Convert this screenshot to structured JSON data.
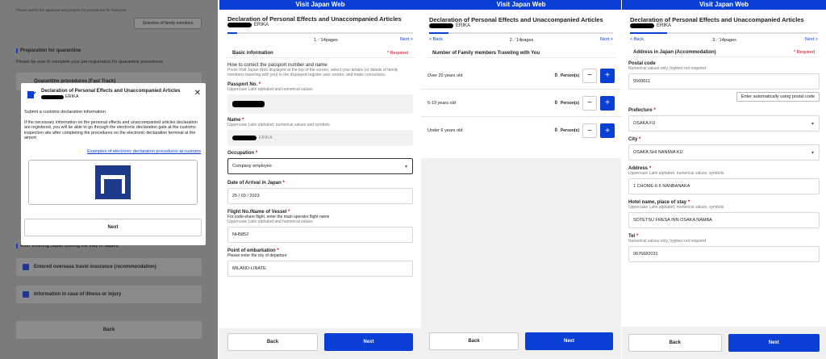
{
  "app_title": "Visit Japan Web",
  "doc_title": "Declaration of Personal Effects and Unaccompanied Articles",
  "name_suffix": "ERIKA",
  "nav": {
    "back": "< Back",
    "next": "Next >"
  },
  "panel1": {
    "top_note": "Please switch the applicant and prepare for procedures for everyone",
    "family_button": "Selection of family members",
    "quarantine_heading": "Preparation for quarantine",
    "quarantine_desc": "Please be sure to complete your pre-registration for quarantine procedures",
    "fast_track": "Quarantine procedures (Fast Track)",
    "after_heading": "After entering Japan (during the stay in Japan)",
    "insurance": "Entered overseas travel insurance (recommendation)",
    "illness": "Information in case of illness or injury",
    "back": "Back",
    "modal": {
      "title": "Declaration of Personal Effects and Unaccompanied Articles",
      "name": "ERIKA",
      "submit": "Submit a customs declaration information",
      "body": "If the necessary information on the personal effects and unaccompanied articles declaration are registered, you will be able to go through the electronic declaration gate at the customs inspection site after completing the procedures on the electronic declaration terminal at the airport",
      "link": "Examples of electronic declaration procedures at customs",
      "next": "Next"
    }
  },
  "panel2": {
    "pages": "1／14pages",
    "section": "Basic information",
    "required": "* Required",
    "how_title": "How to correct the passport number and name",
    "how_desc": "Press Visit Japan Web displayed at the top of the screen, select your details (or details of family members traveling with you) in the displayed register user screen, and make corrections.",
    "passport_label": "Passport No.",
    "passport_hint": "Uppercase Latin alphabet and numerical values",
    "name_label": "Name",
    "name_hint": "Uppercase Latin alphabet, numerical values and symbols",
    "name_value": "ERIKA",
    "occupation_label": "Occupation",
    "occupation_value": "Company employee",
    "arrival_label": "Date of Arrival in Japan",
    "arrival_value": "25 / 03 / 2023",
    "flight_label": "Flight No./Name of Vessel",
    "flight_hint1": "For code-share flight, enter the main operator flight name",
    "flight_hint2": "Uppercase Latin alphabet and numerical values",
    "flight_value": "NH5852",
    "embark_label": "Point of embarkation",
    "embark_hint": "Please enter the city of departure",
    "embark_value": "MILANO-LINATE",
    "back": "Back",
    "next": "Next"
  },
  "panel3": {
    "pages": "2／14pages",
    "section": "Number of Family members Traveling with You",
    "rows": [
      {
        "label": "Over 20 years old",
        "count": "0",
        "unit": "Person(s)"
      },
      {
        "label": "6-19 years old",
        "count": "0",
        "unit": "Person(s)"
      },
      {
        "label": "Under 6 years old",
        "count": "0",
        "unit": "Person(s)"
      }
    ],
    "back": "Back",
    "next": "Next"
  },
  "panel4": {
    "pages": "3／14pages",
    "section": "Address in Japan (Accommodation)",
    "required": "* Required",
    "postal_label": "Postal code",
    "postal_hint": "Numerical values only, hyphen not required",
    "postal_value": "5560011",
    "postal_btn": "Enter automatically using postal code",
    "pref_label": "Prefecture",
    "pref_value": "OSAKA FU",
    "city_label": "City",
    "city_value": "OSAKA SHI NANIWA KU",
    "address_label": "Address",
    "address_hint": "Uppercase Latin alphabet, numerical values, symbols",
    "address_value": "1 CHOME-6-5 NANBANAKA",
    "hotel_label": "Hotel name, place of stay",
    "hotel_hint": "Uppercase Latin alphabet, numerical values, symbols",
    "hotel_value": "SOTETSU FRESA INN OSAKA NAMBA",
    "tel_label": "Tel",
    "tel_hint": "Numerical values only, hyphen not required",
    "tel_value": "0676682031",
    "back": "Back",
    "next": "Next"
  },
  "colors": {
    "brand_blue": "#0a3fd6",
    "required_red": "#d0021b"
  }
}
